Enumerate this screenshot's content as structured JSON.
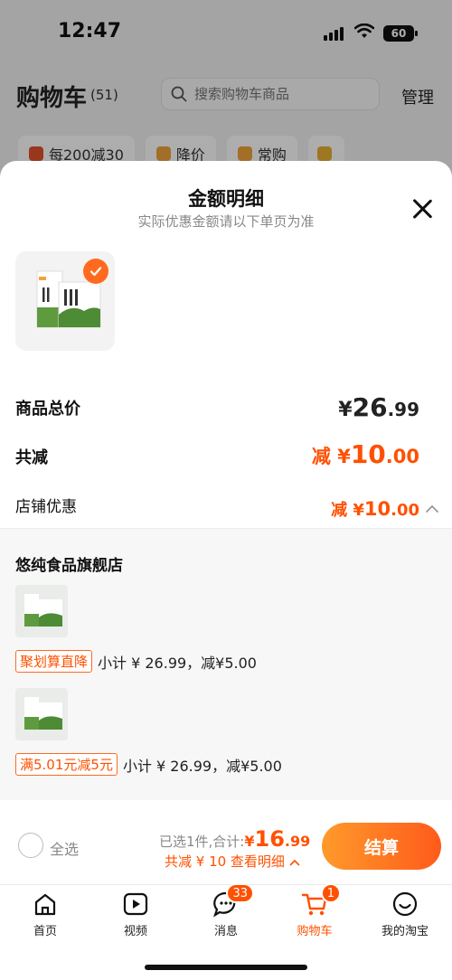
{
  "status_bar": {
    "time": "12:47",
    "battery": "60"
  },
  "header": {
    "title": "购物车",
    "count": "(51)",
    "search_placeholder": "搜索购物车商品",
    "manage": "管理"
  },
  "filter_chips": [
    {
      "label": "每200减30"
    },
    {
      "label": "降价"
    },
    {
      "label": "常购"
    }
  ],
  "sheet": {
    "title": "金额明细",
    "subtitle": "实际优惠金额请以下单页为准",
    "total_price_label": "商品总价",
    "total_price_symbol": "¥",
    "total_price_int": "26",
    "total_price_dec": ".99",
    "reduce_label": "共减",
    "reduce_prefix": "减 ¥",
    "reduce_int": "10",
    "reduce_dec": ".00",
    "store_discount_label": "店铺优惠",
    "store_discount_prefix": "减 ¥",
    "store_discount_int": "10",
    "store_discount_dec": ".00"
  },
  "store": {
    "name": "悠纯食品旗舰店",
    "items": [
      {
        "tag": "聚划算直降",
        "detail": "小计 ¥ 26.99，减¥5.00"
      },
      {
        "tag": "满5.01元减5元",
        "detail": "小计 ¥ 26.99，减¥5.00"
      }
    ]
  },
  "checkout": {
    "select_all": "全选",
    "selected_prefix": "已选1件,合计: ",
    "total_symbol": "¥",
    "total_int": "16",
    "total_dec": ".99",
    "discount_text": "共减 ¥ 10  查看明细",
    "button": "结算"
  },
  "tabbar": {
    "items": [
      {
        "label": "首页"
      },
      {
        "label": "视频"
      },
      {
        "label": "消息",
        "badge": "33"
      },
      {
        "label": "购物车",
        "badge": "1"
      },
      {
        "label": "我的淘宝"
      }
    ]
  },
  "colors": {
    "accent": "#ff5000",
    "button_start": "#ff9a2b",
    "button_end": "#ff5a1a"
  }
}
